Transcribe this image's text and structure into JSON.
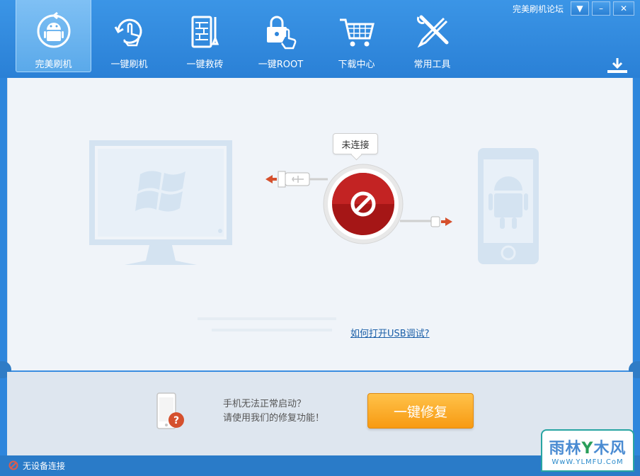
{
  "window": {
    "forum_link": "完美刷机论坛",
    "controls": {
      "menu": "▼",
      "minimize": "–",
      "close": "✕"
    }
  },
  "nav": {
    "items": [
      {
        "label": "完美刷机",
        "icon": "android-sync-icon",
        "active": true
      },
      {
        "label": "一键刷机",
        "icon": "refresh-hand-icon",
        "active": false
      },
      {
        "label": "一键救砖",
        "icon": "brick-wrench-icon",
        "active": false
      },
      {
        "label": "一键ROOT",
        "icon": "lock-hand-icon",
        "active": false
      },
      {
        "label": "下载中心",
        "icon": "cart-icon",
        "active": false
      },
      {
        "label": "常用工具",
        "icon": "tools-icon",
        "active": false
      }
    ]
  },
  "connection": {
    "status": "未连接",
    "usb_help_link": "如何打开USB调试?"
  },
  "repair": {
    "line1": "手机无法正常启动？",
    "line2": "请使用我们的修复功能！",
    "button": "一键修复"
  },
  "statusbar": {
    "text": "无设备连接"
  },
  "watermark": {
    "top_a": "雨林",
    "top_b": "木风",
    "bottom": "WwW.YLMFU.CoM"
  },
  "colors": {
    "header_blue": "#2e86dc",
    "repair_orange": "#f79a12",
    "disconnect_red": "#b01c1c"
  }
}
